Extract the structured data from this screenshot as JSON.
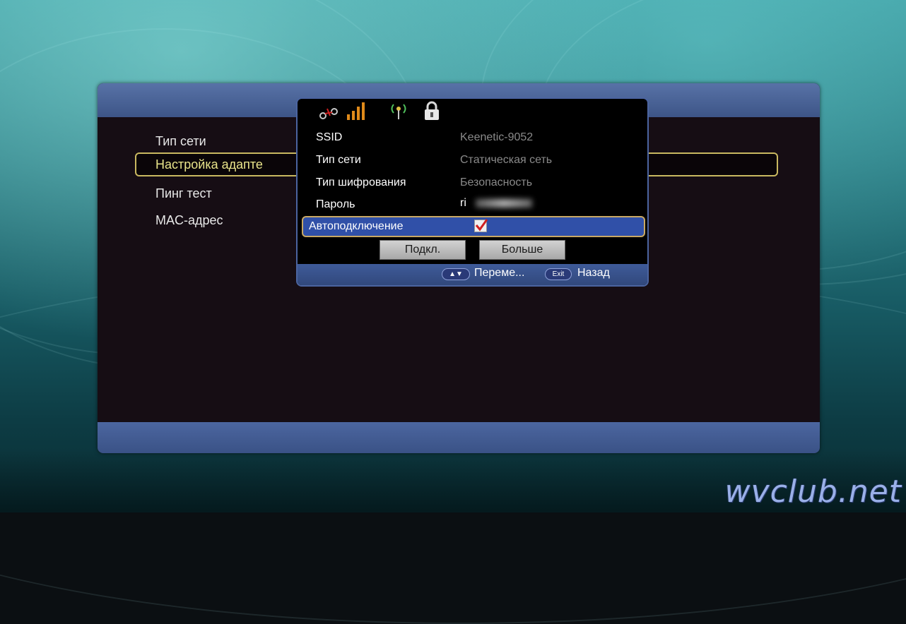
{
  "menu": {
    "items": [
      "Тип сети",
      "Настройка адапте",
      "Пинг тест",
      "MAC-адрес"
    ]
  },
  "dialog": {
    "rows": [
      {
        "label": "SSID",
        "value": "Keenetic-9052"
      },
      {
        "label": "Тип сети",
        "value": "Статическая сеть"
      },
      {
        "label": "Тип шифрования",
        "value": "Безопасность"
      },
      {
        "label": "Пароль",
        "value": "ri"
      }
    ],
    "auto_connect": {
      "label": "Автоподключение",
      "checked": true
    },
    "buttons": {
      "connect": "Подкл.",
      "more": "Больше"
    },
    "hints": {
      "move_key": "▲▼",
      "move_label": "Переме...",
      "exit_key": "Exit",
      "exit_label": "Назад"
    }
  },
  "watermark": "wvclub.net",
  "colors": {
    "panel_bg": "#160d14",
    "header_blue": "#4c66a0",
    "selection_border": "#c9b860",
    "checkbox_mark": "#d02020",
    "wifi_signal": "#e08a1a"
  },
  "icons": [
    "link-icon",
    "signal-bars-icon",
    "wifi-antenna-icon",
    "lock-icon"
  ]
}
